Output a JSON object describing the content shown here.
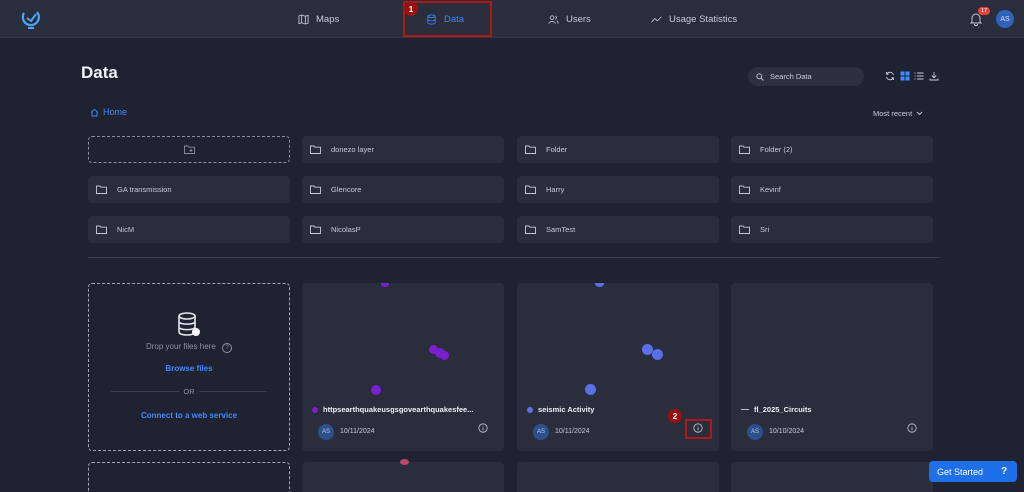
{
  "nav": {
    "items": [
      {
        "label": "Maps",
        "icon": "map-icon"
      },
      {
        "label": "Data",
        "icon": "database-icon",
        "active": true
      },
      {
        "label": "Users",
        "icon": "users-icon"
      },
      {
        "label": "Usage Statistics",
        "icon": "line-chart-icon"
      }
    ],
    "notification_count": "17",
    "user_initials": "AS"
  },
  "annotations": [
    "1",
    "2"
  ],
  "page": {
    "title": "Data",
    "search_placeholder": "Search Data",
    "breadcrumb": "Home",
    "sort_label": "Most recent"
  },
  "folders": [
    "donezo layer",
    "Folder",
    "Folder (2)",
    "GA transmission",
    "Glencore",
    "Harry",
    "Kevinf",
    "NicM",
    "NicolasP",
    "SamTest",
    "Sri"
  ],
  "upload": {
    "drop_text": "Drop your files here",
    "browse": "Browse files",
    "or": "OR",
    "connect": "Connect to a web service"
  },
  "cards": [
    {
      "name": "httpsearthquakeusgsgovearthquakesfee...",
      "owner": "AS",
      "date": "10/11/2024",
      "color": "#7b1fd1"
    },
    {
      "name": "seismic Activity",
      "owner": "AS",
      "date": "10/11/2024",
      "color": "#5b6fe6"
    },
    {
      "name": "fl_2025_Circuits",
      "owner": "AS",
      "date": "10/10/2024",
      "color": "#b7bcc8"
    }
  ],
  "get_started": "Get Started",
  "colors": {
    "accent": "#3f8bff",
    "background": "#1f2230",
    "surface": "#2a2d3b",
    "annotation": "#b31616"
  }
}
